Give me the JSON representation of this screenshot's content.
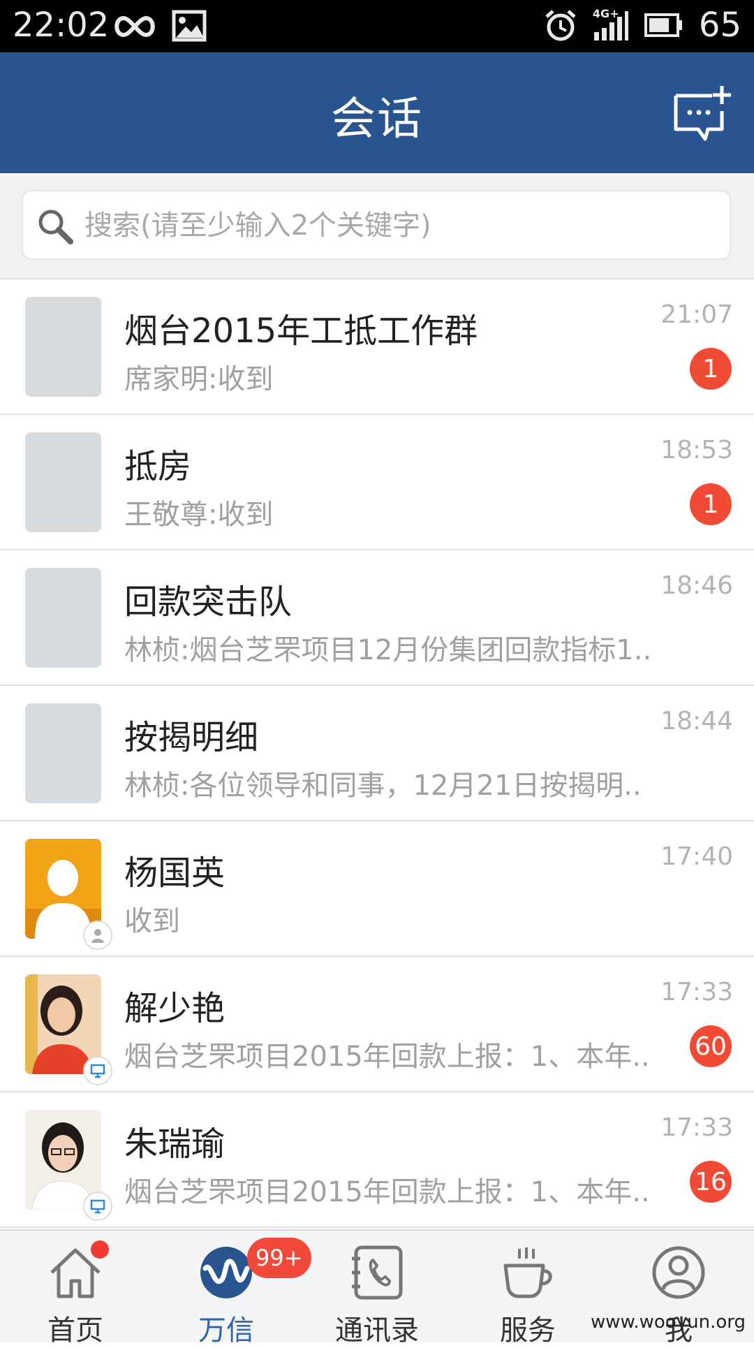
{
  "status_bar": {
    "time": "22:02",
    "battery_percent": "65",
    "network_label": "4G+",
    "icons": [
      "infinity-icon",
      "image-icon",
      "alarm-icon",
      "signal-icon",
      "battery-icon"
    ]
  },
  "header": {
    "title": "会话",
    "new_chat_icon": "new-chat-icon"
  },
  "search": {
    "placeholder": "搜索(请至少输入2个关键字)"
  },
  "colors": {
    "header_bg": "#28558f",
    "badge_red": "#f24b35",
    "active_tab": "#2b64b0"
  },
  "conversations": [
    {
      "name": "烟台2015年工抵工作群",
      "preview": "席家明:收到",
      "time": "21:07",
      "unread": "1",
      "avatar": "group-placeholder"
    },
    {
      "name": "抵房",
      "preview": "王敬尊:收到",
      "time": "18:53",
      "unread": "1",
      "avatar": "group-placeholder"
    },
    {
      "name": "回款突击队",
      "preview": "林桢:烟台芝罘项目12月份集团回款指标1..",
      "time": "18:46",
      "unread": "",
      "avatar": "group-placeholder"
    },
    {
      "name": "按揭明细",
      "preview": "林桢:各位领导和同事，12月21日按揭明..",
      "time": "18:44",
      "unread": "",
      "avatar": "group-placeholder"
    },
    {
      "name": "杨国英",
      "preview": "收到",
      "time": "17:40",
      "unread": "",
      "avatar": "default-female-avatar"
    },
    {
      "name": "解少艳",
      "preview": "烟台芝罘项目2015年回款上报：1、本年..",
      "time": "17:33",
      "unread": "60",
      "avatar": "photo-avatar"
    },
    {
      "name": "朱瑞瑜",
      "preview": "烟台芝罘项目2015年回款上报：1、本年..",
      "time": "17:33",
      "unread": "16",
      "avatar": "photo-avatar"
    }
  ],
  "tabs": [
    {
      "label": "首页",
      "icon": "home-icon",
      "active": false,
      "badge": "dot"
    },
    {
      "label": "万信",
      "icon": "wanxin-icon",
      "active": true,
      "badge": "99+"
    },
    {
      "label": "通讯录",
      "icon": "contacts-icon",
      "active": false,
      "badge": ""
    },
    {
      "label": "服务",
      "icon": "coffee-cup-icon",
      "active": false,
      "badge": ""
    },
    {
      "label": "我",
      "icon": "profile-icon",
      "active": false,
      "badge": ""
    }
  ],
  "watermark": "www.wooyun.org"
}
